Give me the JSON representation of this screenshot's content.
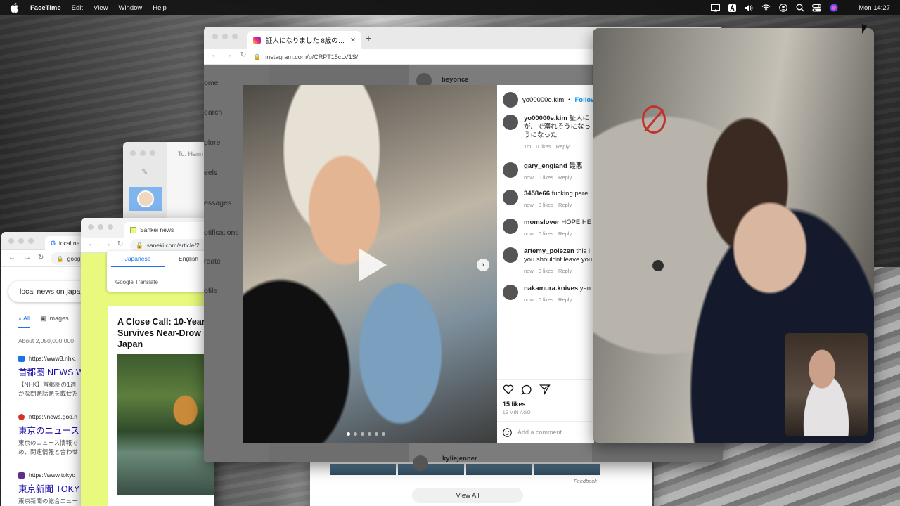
{
  "menubar": {
    "app": "FaceTime",
    "items": [
      "Edit",
      "View",
      "Window",
      "Help"
    ],
    "clock": "Mon 14:27"
  },
  "google": {
    "tab_label": "local ne",
    "address": "goog",
    "query": "local news on japa",
    "tabs": [
      "All",
      "Images"
    ],
    "about": "About 2,050,000,000",
    "results": [
      {
        "url": "https://www3.nhk.",
        "title": "首都圏 NEWS W",
        "snippet1": "【NHK】首都圏の1週",
        "snippet2": "かな問題話題を載せた",
        "fav_color": "#1a73e8"
      },
      {
        "url": "https://news.goo.n",
        "title": "東京のニュース",
        "snippet1": "東京のニュース情報で",
        "snippet2": "め、関連情報と合わせ",
        "fav_color": "#d93025"
      },
      {
        "url": "https://www.tokyo",
        "title": "東京新聞 TOKY",
        "snippet1": "東京新聞の総合ニュー",
        "snippet2": "",
        "fav_color": "#5f2d8a"
      }
    ]
  },
  "mail": {
    "to": "To: Hann"
  },
  "sankei": {
    "tab_label": "Sankei news",
    "address": "saneki.com/article/2",
    "translate": {
      "ja": "Japanese",
      "en": "English",
      "brand": "Google Translate"
    },
    "headline": "A Close Call: 10-Year Survives Near-Drow Japan"
  },
  "viewall": {
    "feedback": "Feedback",
    "button": "View All"
  },
  "instagram": {
    "tab_label": "証人になりました 8歳の…",
    "url": "instagram.com/p/CRPT15cLV1S/",
    "sidebar": [
      "ome",
      "earch",
      "plore",
      "eels",
      "essages",
      "otifications",
      "reate",
      "ofile"
    ],
    "feed_user": "beyonce",
    "feed_user2": "kyliejenner",
    "post_user": "yo00000e.kim",
    "follow": "Follow",
    "comments": [
      {
        "user": "yo00000e.kim",
        "text": "証人に が川で溺れそうになっ うになった",
        "time": "1m",
        "likes": "0 likes",
        "reply": "Reply"
      },
      {
        "user": "gary_england",
        "text": "最悪",
        "time": "now",
        "likes": "0 likes",
        "reply": "Reply"
      },
      {
        "user": "3458e66",
        "text": "fucking pare",
        "time": "now",
        "likes": "0 likes",
        "reply": "Reply"
      },
      {
        "user": "momslover",
        "text": "HOPE HE",
        "time": "now",
        "likes": "0 likes",
        "reply": "Reply"
      },
      {
        "user": "artemy_polezen",
        "text": "this i you shouldnt leave you",
        "time": "now",
        "likes": "0 likes",
        "reply": "Reply"
      },
      {
        "user": "nakamura.knives",
        "text": "yan",
        "time": "now",
        "likes": "0 likes",
        "reply": "Reply"
      }
    ],
    "likes": "15 likes",
    "ago": "15 MIN AGO",
    "add_comment_placeholder": "Add a comment...",
    "carousel_index": 1,
    "carousel_count": 6
  }
}
